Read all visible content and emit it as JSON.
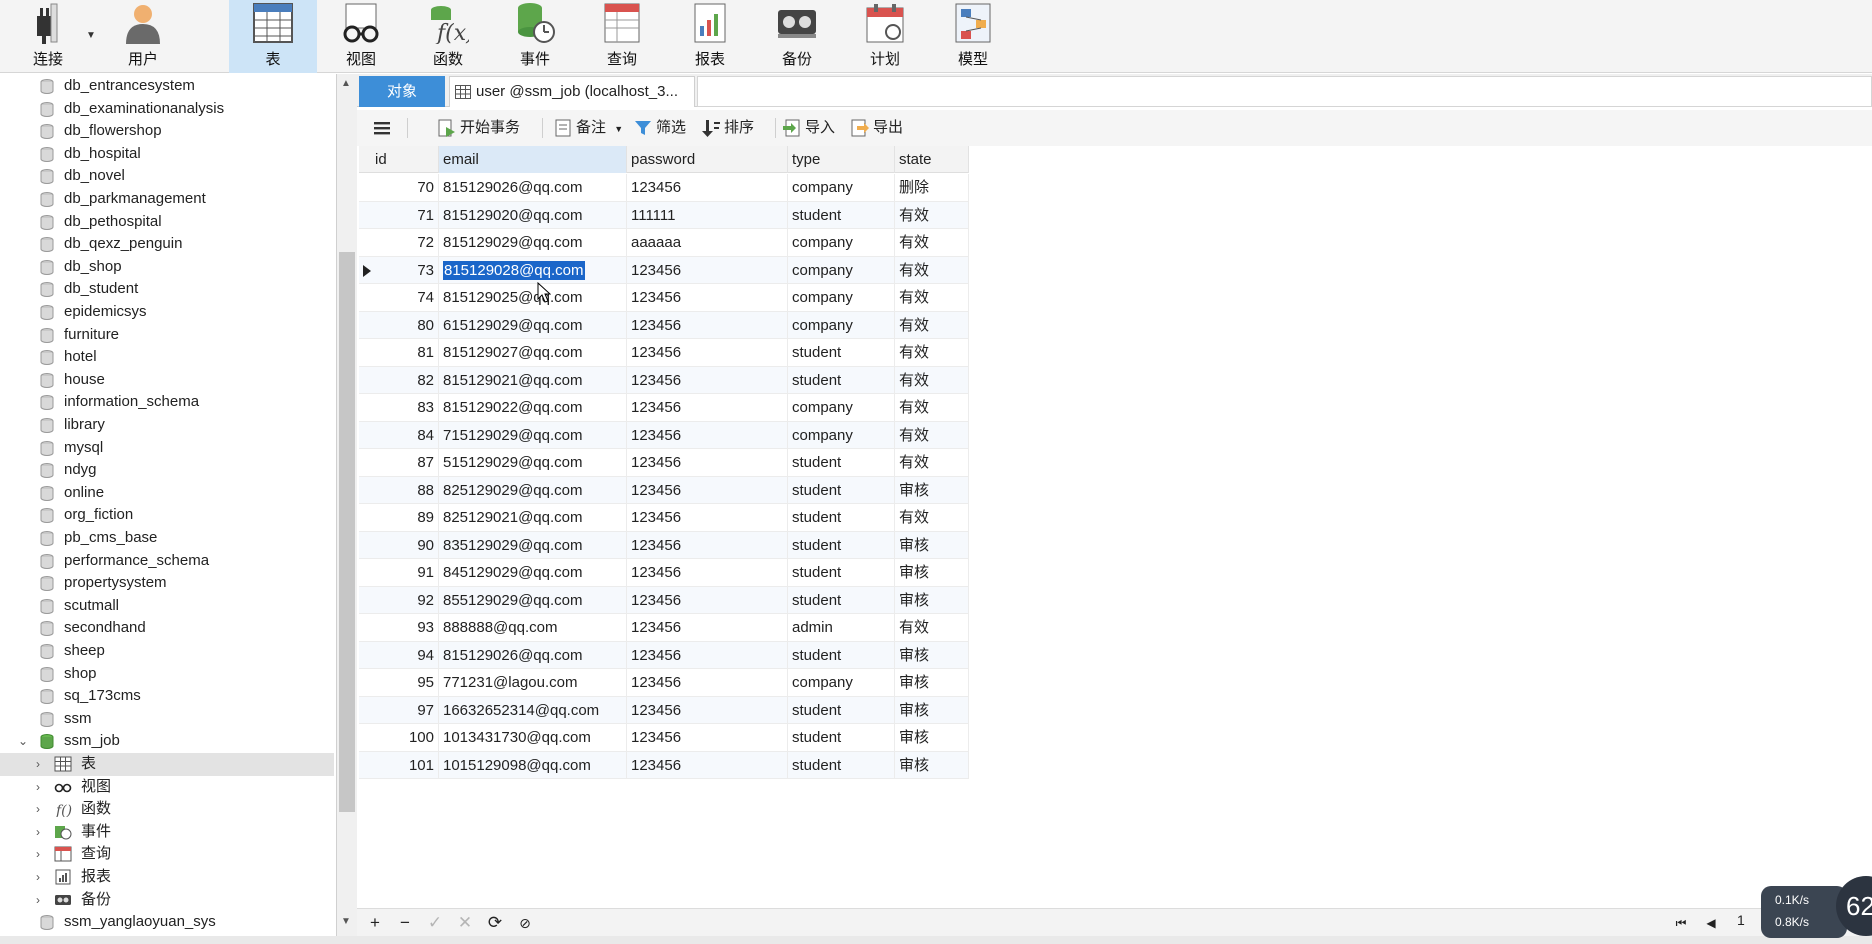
{
  "toolbar": {
    "items": [
      {
        "label": "连接",
        "icon": "plug-icon"
      },
      {
        "label": "用户",
        "icon": "user-icon"
      },
      {
        "label": "表",
        "icon": "table-icon",
        "active": true
      },
      {
        "label": "视图",
        "icon": "glasses-icon"
      },
      {
        "label": "函数",
        "icon": "function-icon"
      },
      {
        "label": "事件",
        "icon": "event-icon"
      },
      {
        "label": "查询",
        "icon": "query-icon"
      },
      {
        "label": "报表",
        "icon": "report-icon"
      },
      {
        "label": "备份",
        "icon": "backup-icon"
      },
      {
        "label": "计划",
        "icon": "schedule-icon"
      },
      {
        "label": "模型",
        "icon": "model-icon"
      }
    ]
  },
  "sidebar": {
    "databases": [
      "db_entrancesystem",
      "db_examinationanalysis",
      "db_flowershop",
      "db_hospital",
      "db_novel",
      "db_parkmanagement",
      "db_pethospital",
      "db_qexz_penguin",
      "db_shop",
      "db_student",
      "epidemicsys",
      "furniture",
      "hotel",
      "house",
      "information_schema",
      "library",
      "mysql",
      "ndyg",
      "online",
      "org_fiction",
      "pb_cms_base",
      "performance_schema",
      "propertysystem",
      "scutmall",
      "secondhand",
      "sheep",
      "shop",
      "sq_173cms",
      "ssm"
    ],
    "open_db": "ssm_job",
    "children": [
      {
        "label": "表",
        "icon": "table-icon"
      },
      {
        "label": "视图",
        "icon": "glasses-icon"
      },
      {
        "label": "函数",
        "icon": "function-icon"
      },
      {
        "label": "事件",
        "icon": "event-icon"
      },
      {
        "label": "查询",
        "icon": "query-icon"
      },
      {
        "label": "报表",
        "icon": "report-icon"
      },
      {
        "label": "备份",
        "icon": "backup-icon"
      }
    ],
    "after": "ssm_yanglaoyuan_sys"
  },
  "tabs": {
    "objects": "对象",
    "query": "user @ssm_job (localhost_3..."
  },
  "subbar": {
    "begin_transaction": "开始事务",
    "memo": "备注",
    "filter": "筛选",
    "sort": "排序",
    "import": "导入",
    "export": "导出"
  },
  "grid": {
    "columns": [
      "id",
      "email",
      "password",
      "type",
      "state"
    ],
    "rows": [
      [
        "70",
        "815129026@qq.com",
        "123456",
        "company",
        "删除"
      ],
      [
        "71",
        "815129020@qq.com",
        "111111",
        "student",
        "有效"
      ],
      [
        "72",
        "815129029@qq.com",
        "aaaaaa",
        "company",
        "有效"
      ],
      [
        "73",
        "815129028@qq.com",
        "123456",
        "company",
        "有效"
      ],
      [
        "74",
        "815129025@qq.com",
        "123456",
        "company",
        "有效"
      ],
      [
        "80",
        "615129029@qq.com",
        "123456",
        "company",
        "有效"
      ],
      [
        "81",
        "815129027@qq.com",
        "123456",
        "student",
        "有效"
      ],
      [
        "82",
        "815129021@qq.com",
        "123456",
        "student",
        "有效"
      ],
      [
        "83",
        "815129022@qq.com",
        "123456",
        "company",
        "有效"
      ],
      [
        "84",
        "715129029@qq.com",
        "123456",
        "company",
        "有效"
      ],
      [
        "87",
        "515129029@qq.com",
        "123456",
        "student",
        "有效"
      ],
      [
        "88",
        "825129029@qq.com",
        "123456",
        "student",
        "审核"
      ],
      [
        "89",
        "825129021@qq.com",
        "123456",
        "student",
        "有效"
      ],
      [
        "90",
        "835129029@qq.com",
        "123456",
        "student",
        "审核"
      ],
      [
        "91",
        "845129029@qq.com",
        "123456",
        "student",
        "审核"
      ],
      [
        "92",
        "855129029@qq.com",
        "123456",
        "student",
        "审核"
      ],
      [
        "93",
        "888888@qq.com",
        "123456",
        "admin",
        "有效"
      ],
      [
        "94",
        "815129026@qq.com",
        "123456",
        "student",
        "审核"
      ],
      [
        "95",
        "771231@lagou.com",
        "123456",
        "company",
        "审核"
      ],
      [
        "97",
        "16632652314@qq.com",
        "123456",
        "student",
        "审核"
      ],
      [
        "100",
        "1013431730@qq.com",
        "123456",
        "student",
        "审核"
      ],
      [
        "101",
        "1015129098@qq.com",
        "123456",
        "student",
        "审核"
      ]
    ],
    "selected_row": 3,
    "selected_column": 1
  },
  "bottombar": {
    "page": "1",
    "net_up": "0.1K/s",
    "net_down": "0.8K/s",
    "bubble": "62"
  },
  "colors": {
    "accent": "#3d8ed8",
    "selection": "#1b66c9",
    "active_tool": "#cde4f7"
  }
}
